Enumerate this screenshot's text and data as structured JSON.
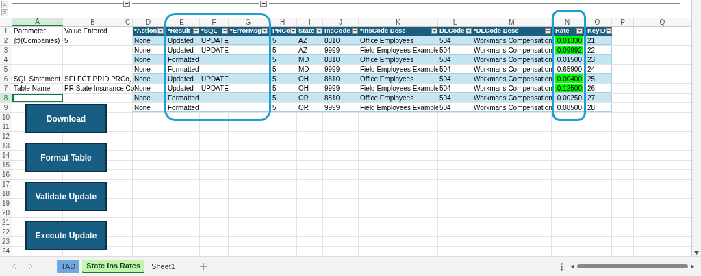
{
  "outline": {
    "levels": [
      "1",
      "2"
    ]
  },
  "columns": [
    {
      "label": "A",
      "selected": true
    },
    {
      "label": "B",
      "selected": false
    },
    {
      "label": "C",
      "selected": false
    },
    {
      "label": "D",
      "selected": false
    },
    {
      "label": "E",
      "selected": false
    },
    {
      "label": "F",
      "selected": false
    },
    {
      "label": "G",
      "selected": false
    },
    {
      "label": "H",
      "selected": false
    },
    {
      "label": "I",
      "selected": false
    },
    {
      "label": "J",
      "selected": false
    },
    {
      "label": "K",
      "selected": false
    },
    {
      "label": "L",
      "selected": false
    },
    {
      "label": "M",
      "selected": false
    },
    {
      "label": "N",
      "selected": false
    },
    {
      "label": "O",
      "selected": false
    },
    {
      "label": "P",
      "selected": false
    },
    {
      "label": "Q",
      "selected": false
    }
  ],
  "rows": [
    {
      "number": "1",
      "selected": false,
      "a": "Parameter",
      "b": "Value Entered"
    },
    {
      "number": "2",
      "selected": false,
      "a": "@(Companies)",
      "b": "5"
    },
    {
      "number": "3",
      "selected": false
    },
    {
      "number": "4",
      "selected": false
    },
    {
      "number": "5",
      "selected": false
    },
    {
      "number": "6",
      "selected": false,
      "a": "SQL Statement",
      "b": "SELECT PRID.PRCo,"
    },
    {
      "number": "7",
      "selected": false,
      "a": "Table Name",
      "b": "PR State Insurance Co"
    },
    {
      "number": "8",
      "selected": true
    },
    {
      "number": "9",
      "selected": false
    },
    {
      "number": "10",
      "selected": false
    },
    {
      "number": "11",
      "selected": false
    },
    {
      "number": "12",
      "selected": false
    },
    {
      "number": "13",
      "selected": false
    },
    {
      "number": "14",
      "selected": false
    },
    {
      "number": "15",
      "selected": false
    },
    {
      "number": "16",
      "selected": false
    },
    {
      "number": "17",
      "selected": false
    },
    {
      "number": "18",
      "selected": false
    },
    {
      "number": "19",
      "selected": false
    },
    {
      "number": "20",
      "selected": false
    },
    {
      "number": "21",
      "selected": false
    },
    {
      "number": "22",
      "selected": false
    },
    {
      "number": "23",
      "selected": false
    },
    {
      "number": "24",
      "selected": false
    }
  ],
  "table": {
    "headers": [
      "*Action",
      "*Result",
      "*SQL",
      "*ErrorMsg",
      "PRCo",
      "State",
      "InsCode",
      "*InsCode Desc",
      "DLCode",
      "*DLCode Desc",
      "Rate",
      "KeyID"
    ],
    "rows": [
      {
        "action": "None",
        "result": "Updated",
        "sql": "UPDATE",
        "prco": "5",
        "state": "AZ",
        "ins_code": "8810",
        "ins_code_desc": "Office Employees",
        "dl_code": "504",
        "dl_code_desc": "Workmans Compensation",
        "rate": "0.01330",
        "rate_highlighted": true,
        "key_id": "21"
      },
      {
        "action": "None",
        "result": "Updated",
        "sql": "UPDATE",
        "prco": "5",
        "state": "AZ",
        "ins_code": "9999",
        "ins_code_desc": "Field Employees Example",
        "dl_code": "504",
        "dl_code_desc": "Workmans Compensation",
        "rate": "0.09992",
        "rate_highlighted": true,
        "key_id": "22"
      },
      {
        "action": "None",
        "result": "Formatted",
        "prco": "5",
        "state": "MD",
        "ins_code": "8810",
        "ins_code_desc": "Office Employees",
        "dl_code": "504",
        "dl_code_desc": "Workmans Compensation",
        "rate": "0.01500",
        "rate_highlighted": false,
        "key_id": "23"
      },
      {
        "action": "None",
        "result": "Formatted",
        "prco": "5",
        "state": "MD",
        "ins_code": "9999",
        "ins_code_desc": "Field Employees Example",
        "dl_code": "504",
        "dl_code_desc": "Workmans Compensation",
        "rate": "0.65900",
        "rate_highlighted": false,
        "key_id": "24"
      },
      {
        "action": "None",
        "result": "Updated",
        "sql": "UPDATE",
        "prco": "5",
        "state": "OH",
        "ins_code": "8810",
        "ins_code_desc": "Office Employees",
        "dl_code": "504",
        "dl_code_desc": "Workmans Compensation",
        "rate": "0.00400",
        "rate_highlighted": true,
        "key_id": "25"
      },
      {
        "action": "None",
        "result": "Updated",
        "sql": "UPDATE",
        "prco": "5",
        "state": "OH",
        "ins_code": "9999",
        "ins_code_desc": "Field Employees Example",
        "dl_code": "504",
        "dl_code_desc": "Workmans Compensation",
        "rate": "0.12500",
        "rate_highlighted": true,
        "key_id": "26"
      },
      {
        "action": "None",
        "result": "Formatted",
        "prco": "5",
        "state": "OR",
        "ins_code": "8810",
        "ins_code_desc": "Office Employees",
        "dl_code": "504",
        "dl_code_desc": "Workmans Compensation",
        "rate": "0.00250",
        "rate_highlighted": false,
        "key_id": "27"
      },
      {
        "action": "None",
        "result": "Formatted",
        "prco": "5",
        "state": "OR",
        "ins_code": "9999",
        "ins_code_desc": "Field Employees Example",
        "dl_code": "504",
        "dl_code_desc": "Workmans Compensation",
        "rate": "0.08500",
        "rate_highlighted": false,
        "key_id": "28"
      }
    ]
  },
  "buttons": [
    "Download",
    "Format Table",
    "Validate Update",
    "Execute Update"
  ],
  "sheet_tabs": [
    {
      "label": "TAD",
      "selected": false,
      "color": "#6fa8e0"
    },
    {
      "label": "State Ins Rates",
      "selected": true,
      "color": "#c2f5b0"
    },
    {
      "label": "Sheet1",
      "selected": false
    }
  ]
}
